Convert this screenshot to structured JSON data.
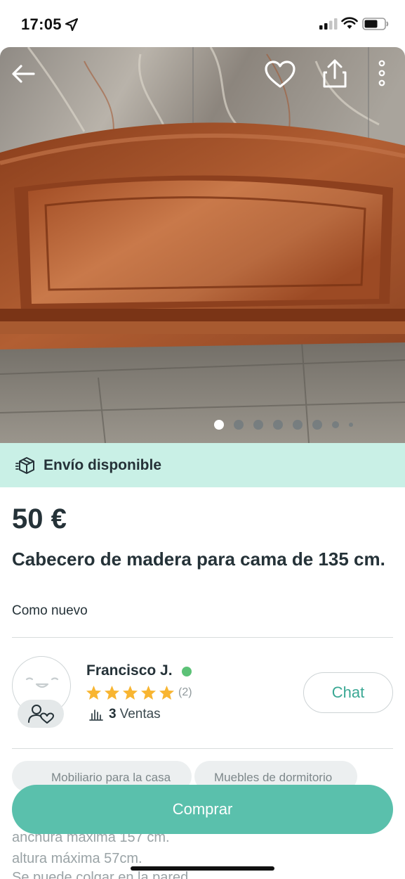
{
  "status_bar": {
    "time": "17:05"
  },
  "listing": {
    "photo_count": 8,
    "active_photo_index": 0,
    "shipping_label": "Envío disponible",
    "price": "50 €",
    "title": "Cabecero de madera  para cama de  135 cm.",
    "condition": "Como nuevo"
  },
  "seller": {
    "name": "Francisco J.",
    "online": true,
    "rating_stars": 5,
    "rating_count": "(2)",
    "sales_count": "3",
    "sales_label": "Ventas",
    "chat_label": "Chat"
  },
  "categories": [
    "Mobiliario para la casa",
    "Muebles de dormitorio"
  ],
  "description_lines": [
    " anchura  máxima  157 cm.",
    "altura máxima   57cm.",
    "Se puede colgar en la  pared"
  ],
  "buy_label": "Comprar",
  "colors": {
    "accent": "#5ac0ac",
    "shipping_banner": "#c9f0e6",
    "text": "#253238",
    "star": "#f8b531",
    "online": "#5cc277"
  },
  "icons": [
    "location-arrow-icon",
    "signal-icon",
    "wifi-icon",
    "battery-icon",
    "back-arrow-icon",
    "heart-icon",
    "share-icon",
    "more-vertical-icon",
    "package-icon",
    "star-icon",
    "sales-chart-icon",
    "profile-heart-icon"
  ]
}
